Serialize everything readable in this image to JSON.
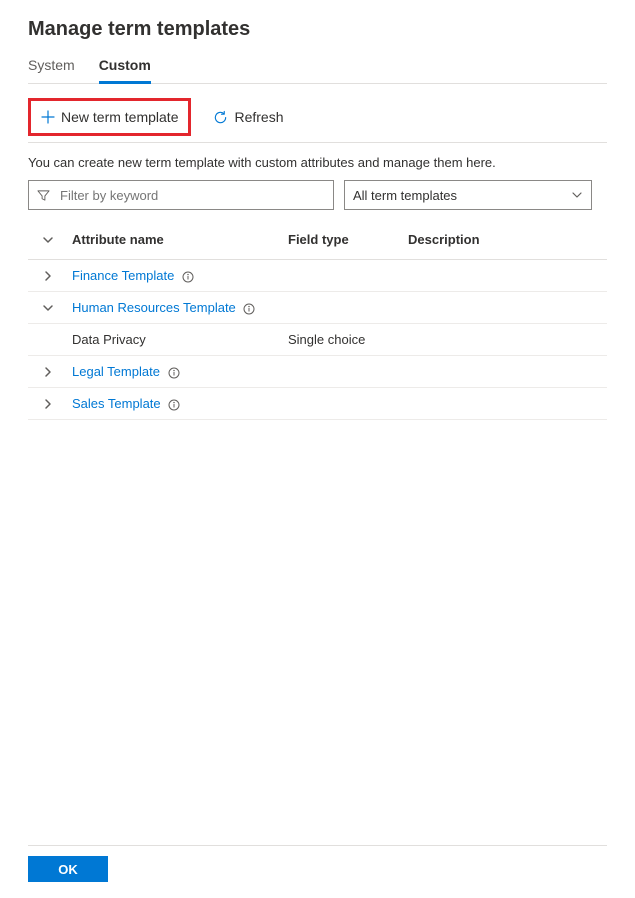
{
  "title": "Manage term templates",
  "tabs": {
    "system": "System",
    "custom": "Custom",
    "active": "custom"
  },
  "toolbar": {
    "new_template": "New term template",
    "refresh": "Refresh"
  },
  "info_text": "You can create new term template with custom attributes and manage them here.",
  "filter": {
    "placeholder": "Filter by keyword"
  },
  "dropdown": {
    "selected": "All term templates"
  },
  "columns": {
    "name": "Attribute name",
    "field": "Field type",
    "desc": "Description"
  },
  "rows": [
    {
      "type": "template",
      "expanded": false,
      "name": "Finance Template"
    },
    {
      "type": "template",
      "expanded": true,
      "name": "Human Resources Template"
    },
    {
      "type": "attribute",
      "name": "Data Privacy",
      "field": "Single choice"
    },
    {
      "type": "template",
      "expanded": false,
      "name": "Legal Template"
    },
    {
      "type": "template",
      "expanded": false,
      "name": "Sales Template"
    }
  ],
  "footer": {
    "ok": "OK"
  }
}
